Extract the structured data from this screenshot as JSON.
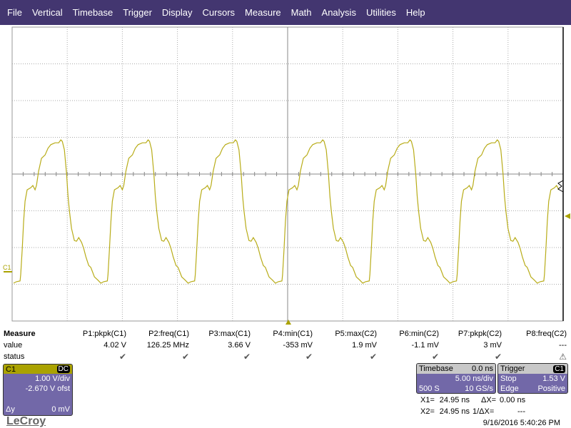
{
  "menu": [
    "File",
    "Vertical",
    "Timebase",
    "Trigger",
    "Display",
    "Cursors",
    "Measure",
    "Math",
    "Analysis",
    "Utilities",
    "Help"
  ],
  "measure": {
    "title": "Measure",
    "value_label": "value",
    "status_label": "status",
    "params": [
      {
        "name": "P1:pkpk(C1)",
        "value": "4.02 V",
        "status": "ok"
      },
      {
        "name": "P2:freq(C1)",
        "value": "126.25 MHz",
        "status": "ok"
      },
      {
        "name": "P3:max(C1)",
        "value": "3.66 V",
        "status": "ok"
      },
      {
        "name": "P4:min(C1)",
        "value": "-353 mV",
        "status": "ok"
      },
      {
        "name": "P5:max(C2)",
        "value": "1.9 mV",
        "status": "ok"
      },
      {
        "name": "P6:min(C2)",
        "value": "-1.1 mV",
        "status": "ok"
      },
      {
        "name": "P7:pkpk(C2)",
        "value": "3 mV",
        "status": "ok"
      },
      {
        "name": "P8:freq(C2)",
        "value": "---",
        "status": "warning"
      }
    ]
  },
  "channel": {
    "name": "C1",
    "coupling": "DC",
    "vdiv": "1.00 V/div",
    "offset": "-2.670 V ofst",
    "dy_label": "Δy",
    "dy": "0 mV",
    "color": "#aaa200",
    "trace_color": "#b8ac18"
  },
  "timebase": {
    "title": "Timebase",
    "delay": "0.0 ns",
    "tdiv": "5.00 ns/div",
    "samples": "500 S",
    "rate": "10 GS/s"
  },
  "trigger": {
    "title": "Trigger",
    "source": "C1",
    "mode": "Stop",
    "level": "1.53 V",
    "type": "Edge",
    "slope": "Positive"
  },
  "cursors": {
    "x1_label": "X1=",
    "x1": "24.95 ns",
    "dx_label": "ΔX=",
    "dx": "0.00 ns",
    "x2_label": "X2=",
    "x2": "24.95 ns",
    "inv_label": "1/ΔX=",
    "inv": "---"
  },
  "timestamp": "9/16/2016 5:40:26 PM",
  "brand": "LeCroy",
  "colors": {
    "menu": "#433670",
    "panel": "#7268a8"
  },
  "chart_data": {
    "type": "line",
    "xlim_ns": [
      -25,
      25
    ],
    "ylim_V": [
      -1.33,
      6.67
    ],
    "grid": true,
    "first_rising_edge_ns": -24.22,
    "cycle": {
      "t_ns": [
        0,
        0.13,
        0.26,
        0.39,
        0.58,
        0.91,
        1.1,
        1.3,
        1.43,
        1.62,
        1.88,
        2.21,
        2.47,
        2.73,
        3.12,
        3.44,
        3.64,
        3.77,
        3.96,
        4.16,
        4.29,
        4.42,
        4.61,
        4.87,
        5.06,
        5.26,
        5.52,
        5.71,
        5.91,
        6.17,
        6.36,
        6.49,
        6.69,
        7.01,
        7.27,
        7.53,
        7.86
      ],
      "v": [
        -0.07,
        0.61,
        1.38,
        1.93,
        2.24,
        2.3,
        2.36,
        2.24,
        2.36,
        2.75,
        3.1,
        3.19,
        3.37,
        3.47,
        3.52,
        3.52,
        3.6,
        3.56,
        3.33,
        2.67,
        2.07,
        1.66,
        1.19,
        0.86,
        0.84,
        0.94,
        0.81,
        0.65,
        0.42,
        0.18,
        0.13,
        0.03,
        -0.13,
        -0.22,
        -0.3,
        -0.26,
        -0.24
      ]
    }
  }
}
